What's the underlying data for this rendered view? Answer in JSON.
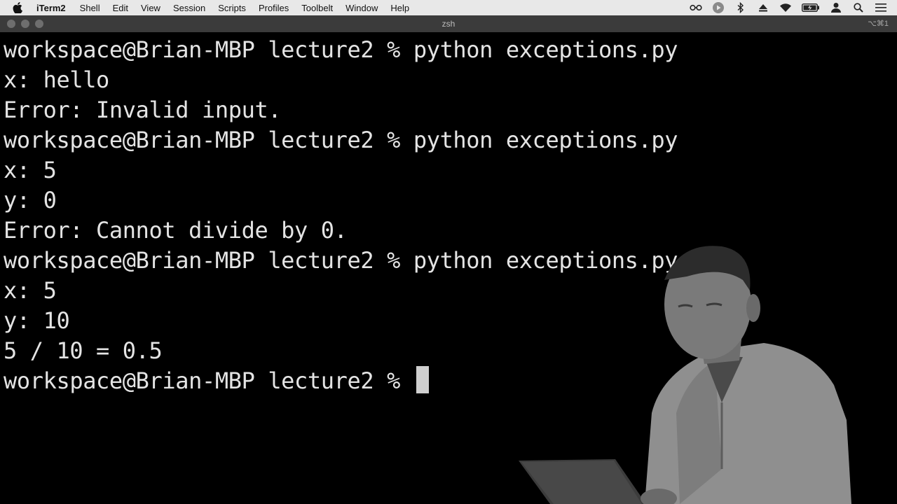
{
  "menubar": {
    "app_name": "iTerm2",
    "items": [
      "Shell",
      "Edit",
      "View",
      "Session",
      "Scripts",
      "Profiles",
      "Toolbelt",
      "Window",
      "Help"
    ],
    "status_icons": [
      "glasses-icon",
      "play-icon",
      "bluetooth-icon",
      "eject-icon",
      "wifi-icon",
      "battery-icon",
      "user-icon",
      "search-icon",
      "list-icon"
    ]
  },
  "window": {
    "title": "zsh",
    "shortcut": "⌥⌘1"
  },
  "terminal": {
    "lines": [
      "workspace@Brian-MBP lecture2 % python exceptions.py",
      "x: hello",
      "Error: Invalid input.",
      "workspace@Brian-MBP lecture2 % python exceptions.py",
      "x: 5",
      "y: 0",
      "Error: Cannot divide by 0.",
      "workspace@Brian-MBP lecture2 % python exceptions.py",
      "x: 5",
      "y: 10",
      "5 / 10 = 0.5",
      "workspace@Brian-MBP lecture2 % "
    ]
  },
  "colors": {
    "terminal_bg": "#000000",
    "terminal_fg": "#e4e4e4",
    "menubar_bg": "#e8e8e8",
    "titlebar_bg": "#3b3b3b"
  }
}
